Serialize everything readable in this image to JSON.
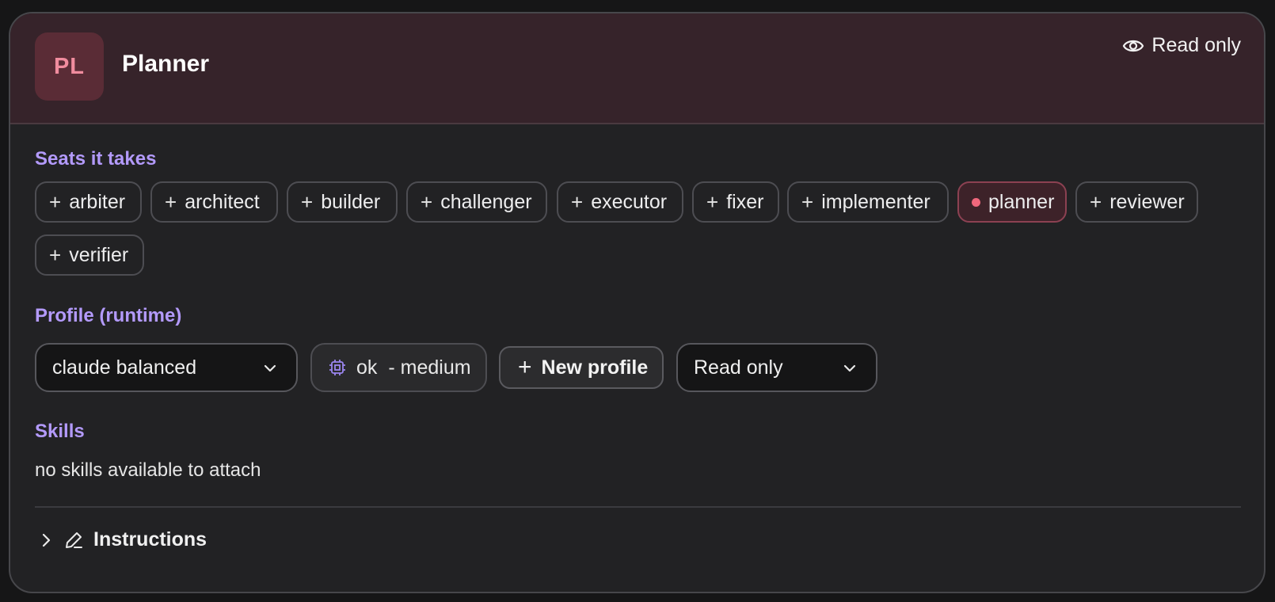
{
  "agent": {
    "initials": "PL",
    "name": "Planner",
    "mode_label": "Read only"
  },
  "seats": {
    "label": "Seats it takes",
    "items": [
      {
        "label": "arbiter",
        "active": false
      },
      {
        "label": "architect",
        "active": false
      },
      {
        "label": "builder",
        "active": false
      },
      {
        "label": "challenger",
        "active": false
      },
      {
        "label": "executor",
        "active": false
      },
      {
        "label": "fixer",
        "active": false
      },
      {
        "label": "implementer",
        "active": false
      },
      {
        "label": "planner",
        "active": true
      },
      {
        "label": "reviewer",
        "active": false
      },
      {
        "label": "verifier",
        "active": false
      }
    ]
  },
  "profile": {
    "label": "Profile (runtime)",
    "selected": "claude balanced",
    "model_name": "ok",
    "model_effort": "- medium",
    "new_profile_label": "New profile",
    "permission_selected": "Read only"
  },
  "skills": {
    "label": "Skills",
    "empty_text": "no skills available to attach"
  },
  "instructions": {
    "label": "Instructions"
  },
  "icons": {
    "mode": "eye-icon",
    "plus": "plus-icon",
    "active": "dot-icon",
    "dropdown": "chevron-down-icon",
    "model": "cpu-chip-icon",
    "expand": "chevron-right-icon",
    "edit": "pencil-icon"
  },
  "colors": {
    "accent_label": "#b39afb",
    "header_bg": "#36232a",
    "active_dot": "#f0677c",
    "avatar_text": "#f08c9e"
  }
}
